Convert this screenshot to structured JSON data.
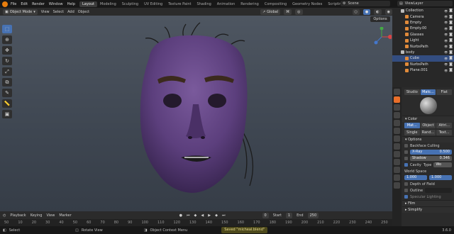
{
  "menu": [
    "File",
    "Edit",
    "Render",
    "Window",
    "Help"
  ],
  "workspaces": [
    "Layout",
    "Modeling",
    "Sculpting",
    "UV Editing",
    "Texture Paint",
    "Shading",
    "Animation",
    "Rendering",
    "Compositing",
    "Geometry Nodes",
    "Scripting"
  ],
  "active_workspace": "Layout",
  "scene": "Scene",
  "view_layer": "ViewLayer",
  "viewport_header": {
    "mode": "Object Mode",
    "items": [
      "View",
      "Select",
      "Add",
      "Object"
    ],
    "orientation": "Global",
    "options": "Options"
  },
  "outliner": [
    {
      "name": "Collection",
      "sel": false
    },
    {
      "name": "Camera",
      "sel": false
    },
    {
      "name": "Empty",
      "sel": false
    },
    {
      "name": "Empty.00",
      "sel": false
    },
    {
      "name": "Glasses",
      "sel": false
    },
    {
      "name": "Light",
      "sel": false
    },
    {
      "name": "NurbsPath",
      "sel": false
    },
    {
      "name": "body",
      "sel": false
    },
    {
      "name": "Cube",
      "sel": true
    },
    {
      "name": "NurbsPath",
      "sel": false
    },
    {
      "name": "Plane.001",
      "sel": false
    }
  ],
  "render_tabs": [
    "Studio",
    "Matc...",
    "Flat"
  ],
  "color": {
    "label": "Color",
    "options": [
      "Mat...",
      "Object",
      "Attri..."
    ],
    "options2": [
      "Single",
      "Rand...",
      "Text..."
    ]
  },
  "options_section": {
    "label": "Options",
    "backface": "Backface Culling",
    "xray": "X-Ray",
    "xray_val": "0.500",
    "shadow": "Shadow",
    "shadow_val": "0.346",
    "cavity": "Cavity",
    "type": "Type",
    "type_val": "Wo",
    "world_space": "World Space",
    "ws1": "1.000",
    "ws2": "1.000",
    "dof": "Depth of Field",
    "outline": "Outline",
    "specular": "Specular Lighting"
  },
  "film": "Film",
  "simplify": "Simplify",
  "timeline": {
    "items": [
      "Playback",
      "Keying",
      "View",
      "Marker"
    ],
    "frame": "0",
    "start_label": "Start",
    "start": "1",
    "end_label": "End",
    "end": "250"
  },
  "ruler": [
    "50",
    "10",
    "20",
    "30",
    "40",
    "50",
    "60",
    "70",
    "80",
    "90",
    "100",
    "110",
    "120",
    "130",
    "140",
    "150",
    "160",
    "170",
    "180",
    "190",
    "200",
    "210",
    "220",
    "230",
    "240",
    "250"
  ],
  "status": {
    "select": "Select",
    "rotate": "Rotate View",
    "context": "Object Context Menu",
    "saved": "Saved \"micheal.blend\"",
    "version": "3.6.0"
  },
  "colors": {
    "accent": "#4772b3",
    "brand": "#e87d0d",
    "face": "#5a3d7a",
    "active_tab": "#ea6f2a"
  }
}
